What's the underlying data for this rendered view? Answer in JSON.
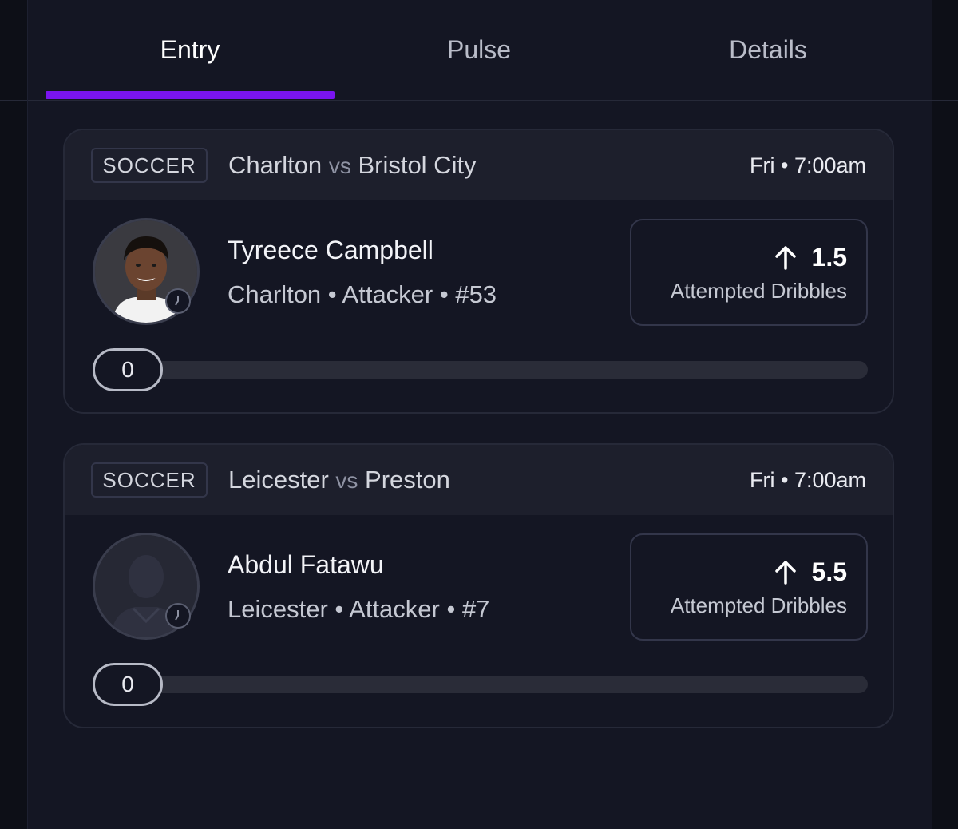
{
  "tabs": [
    {
      "label": "Entry",
      "active": true
    },
    {
      "label": "Pulse",
      "active": false
    },
    {
      "label": "Details",
      "active": false
    }
  ],
  "accent_color": "#7a14f0",
  "picks": [
    {
      "sport": "SOCCER",
      "home_team": "Charlton",
      "vs": "vs",
      "away_team": "Bristol City",
      "time": "Fri • 7:00am",
      "player_name": "Tyreece Campbell",
      "player_info": "Charlton • Attacker • #53",
      "avatar": "player-photo",
      "direction_icon": "arrow-up-icon",
      "line": "1.5",
      "stat": "Attempted Dribbles",
      "progress_value": "0",
      "progress_fraction": 0
    },
    {
      "sport": "SOCCER",
      "home_team": "Leicester",
      "vs": "vs",
      "away_team": "Preston",
      "time": "Fri • 7:00am",
      "player_name": "Abdul Fatawu",
      "player_info": "Leicester • Attacker • #7",
      "avatar": "player-silhouette",
      "direction_icon": "arrow-up-icon",
      "line": "5.5",
      "stat": "Attempted Dribbles",
      "progress_value": "0",
      "progress_fraction": 0
    }
  ]
}
